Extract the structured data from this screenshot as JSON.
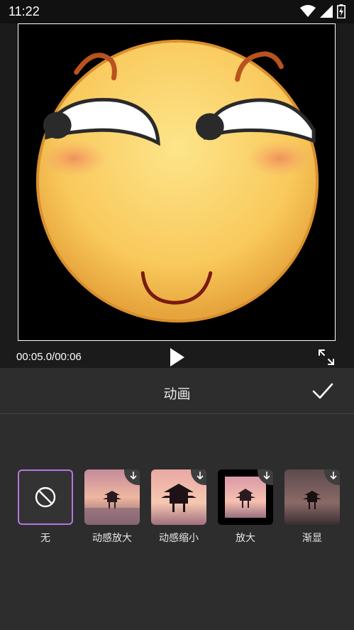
{
  "status_bar": {
    "time": "11:22"
  },
  "player": {
    "time": "00:05.0/00:06"
  },
  "panel": {
    "title": "动画",
    "items": [
      {
        "label": "无",
        "selected": true
      },
      {
        "label": "动感放大",
        "downloadable": true
      },
      {
        "label": "动感缩小",
        "downloadable": true
      },
      {
        "label": "放大",
        "downloadable": true
      },
      {
        "label": "渐显",
        "downloadable": true
      }
    ]
  },
  "colors": {
    "accent": "#b476e0",
    "panel_bg": "#2d2d2d"
  }
}
